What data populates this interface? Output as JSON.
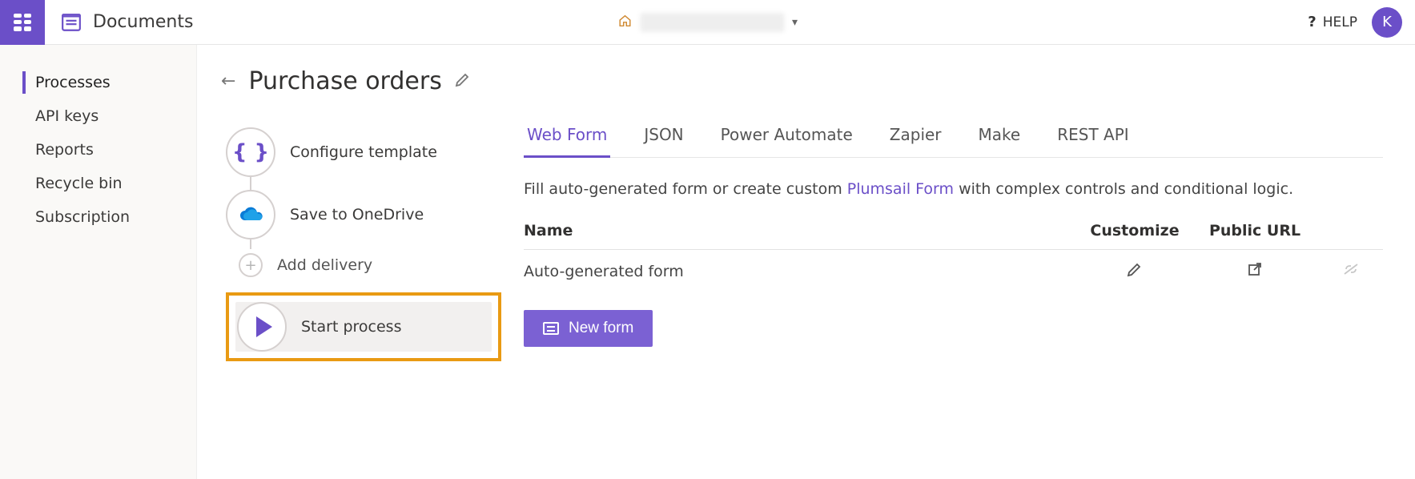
{
  "topbar": {
    "title": "Documents",
    "help_label": "HELP",
    "avatar_initial": "K"
  },
  "sidebar": {
    "items": [
      {
        "label": "Processes",
        "active": true
      },
      {
        "label": "API keys",
        "active": false
      },
      {
        "label": "Reports",
        "active": false
      },
      {
        "label": "Recycle bin",
        "active": false
      },
      {
        "label": "Subscription",
        "active": false
      }
    ]
  },
  "process": {
    "title": "Purchase orders",
    "steps": {
      "configure": "Configure template",
      "onedrive": "Save to OneDrive",
      "add_delivery": "Add delivery",
      "start": "Start process"
    }
  },
  "tabs": [
    {
      "label": "Web Form",
      "active": true
    },
    {
      "label": "JSON"
    },
    {
      "label": "Power Automate"
    },
    {
      "label": "Zapier"
    },
    {
      "label": "Make"
    },
    {
      "label": "REST API"
    }
  ],
  "description": {
    "prefix": "Fill auto-generated form or create custom ",
    "link": "Plumsail Form",
    "suffix": " with complex controls and conditional logic."
  },
  "forms_table": {
    "headers": {
      "name": "Name",
      "customize": "Customize",
      "public": "Public URL"
    },
    "rows": [
      {
        "name": "Auto-generated form"
      }
    ]
  },
  "buttons": {
    "new_form": "New form"
  }
}
